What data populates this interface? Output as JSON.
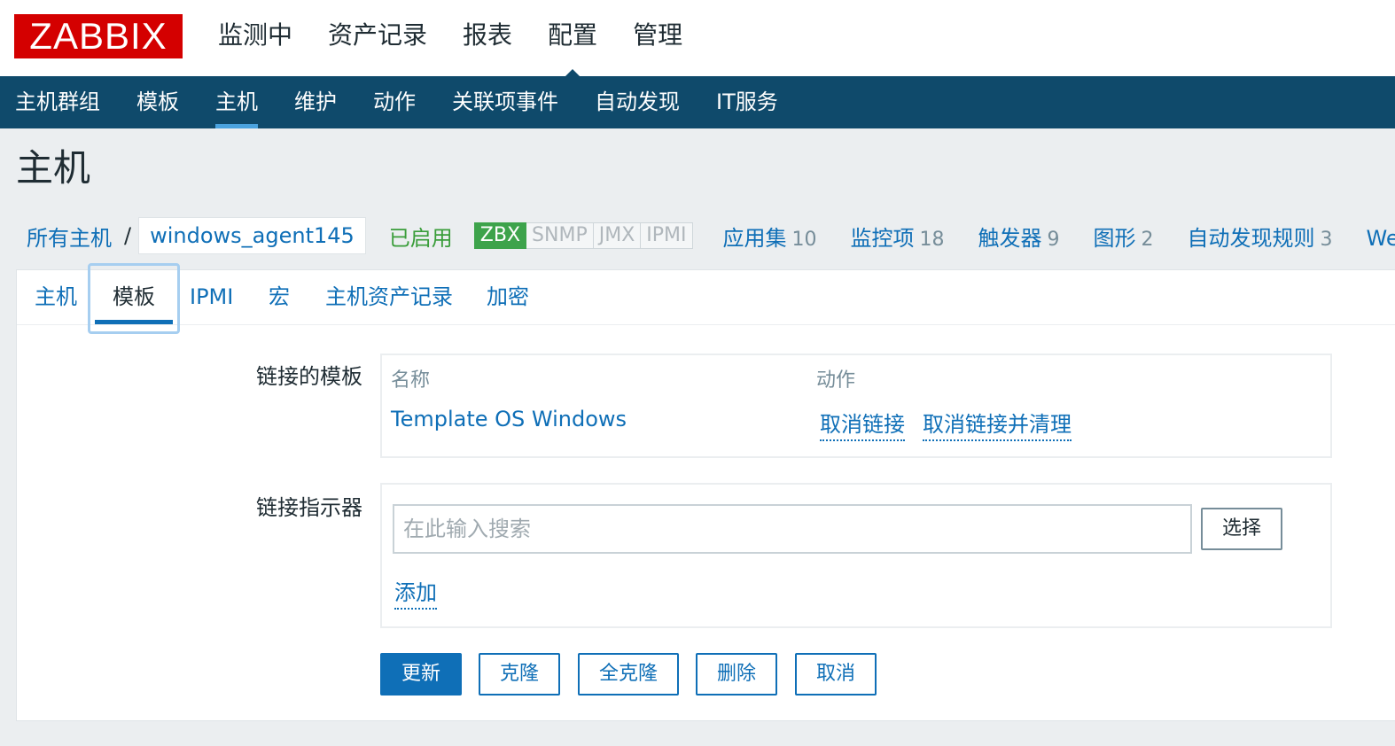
{
  "logo": "ZABBIX",
  "main_menu": [
    "监测中",
    "资产记录",
    "报表",
    "配置",
    "管理"
  ],
  "main_menu_active": "配置",
  "sub_nav": [
    "主机群组",
    "模板",
    "主机",
    "维护",
    "动作",
    "关联项事件",
    "自动发现",
    "IT服务"
  ],
  "sub_nav_active": "主机",
  "page_title": "主机",
  "breadcrumb": {
    "all_hosts": "所有主机",
    "separator": "/",
    "host": "windows_agent145",
    "status": "已启用"
  },
  "availability": [
    "ZBX",
    "SNMP",
    "JMX",
    "IPMI"
  ],
  "host_links": [
    {
      "label": "应用集",
      "count": "10"
    },
    {
      "label": "监控项",
      "count": "18"
    },
    {
      "label": "触发器",
      "count": "9"
    },
    {
      "label": "图形",
      "count": "2"
    },
    {
      "label": "自动发现规则",
      "count": "3"
    },
    {
      "label": "Web 场",
      "count": ""
    }
  ],
  "tabs": [
    "主机",
    "模板",
    "IPMI",
    "宏",
    "主机资产记录",
    "加密"
  ],
  "tab_active": "模板",
  "linked_templates": {
    "label": "链接的模板",
    "col_name": "名称",
    "col_action": "动作",
    "rows": [
      {
        "name": "Template OS Windows",
        "unlink": "取消链接",
        "unlink_clear": "取消链接并清理"
      }
    ]
  },
  "link_new": {
    "label": "链接指示器",
    "placeholder": "在此输入搜索",
    "select_button": "选择",
    "add_link": "添加"
  },
  "buttons": {
    "update": "更新",
    "clone": "克隆",
    "full_clone": "全克隆",
    "delete": "删除",
    "cancel": "取消"
  },
  "colors": {
    "brand_red": "#d40000",
    "nav_blue": "#0f4a6b",
    "link_blue": "#0f6fb7",
    "enabled_green": "#3a9d3a",
    "zbx_green": "#3da34b"
  }
}
